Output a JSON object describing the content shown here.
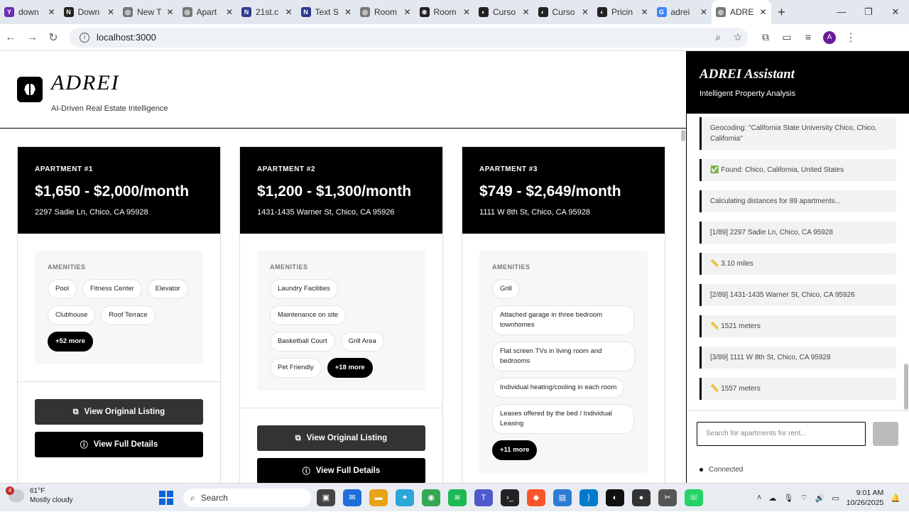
{
  "browser": {
    "tabs": [
      {
        "label": "down",
        "color": "#6b2fb3",
        "glyph": "Y"
      },
      {
        "label": "Down",
        "color": "#222",
        "glyph": "N"
      },
      {
        "label": "New T",
        "color": "#777",
        "glyph": "◎"
      },
      {
        "label": "Apart",
        "color": "#777",
        "glyph": "◎"
      },
      {
        "label": "21st.c",
        "color": "#2b3a8f",
        "glyph": "N"
      },
      {
        "label": "Text S",
        "color": "#2b3a8f",
        "glyph": "N"
      },
      {
        "label": "Room",
        "color": "#777",
        "glyph": "◎"
      },
      {
        "label": "Room",
        "color": "#222",
        "glyph": "⊛"
      },
      {
        "label": "Curso",
        "color": "#222",
        "glyph": "◐"
      },
      {
        "label": "Curso",
        "color": "#222",
        "glyph": "◐"
      },
      {
        "label": "Pricin",
        "color": "#222",
        "glyph": "◐"
      },
      {
        "label": "adrei",
        "color": "#4285f4",
        "glyph": "G"
      },
      {
        "label": "ADRE",
        "color": "#777",
        "glyph": "◎"
      }
    ],
    "url": "localhost:3000"
  },
  "header": {
    "brand": "ADREI",
    "tagline": "AI-Driven Real Estate Intelligence"
  },
  "apartments": [
    {
      "label": "APARTMENT #1",
      "price": "$1,650 - $2,000/month",
      "address": "2297 Sadie Ln, Chico, CA 95928",
      "amenities_title": "AMENITIES",
      "amenities": [
        "Pool",
        "Fitness Center",
        "Elevator",
        "Clubhouse",
        "Roof Terrace"
      ],
      "more": "+52 more",
      "view_listing": "View Original Listing",
      "view_details": "View Full Details"
    },
    {
      "label": "APARTMENT #2",
      "price": "$1,200 - $1,300/month",
      "address": "1431-1435 Warner St, Chico, CA 95926",
      "amenities_title": "AMENITIES",
      "amenities": [
        "Laundry Facilities",
        "Maintenance on site",
        "Basketball Court",
        "Grill Area",
        "Pet Friendly"
      ],
      "more": "+18 more",
      "view_listing": "View Original Listing",
      "view_details": "View Full Details"
    },
    {
      "label": "APARTMENT #3",
      "price": "$749 - $2,649/month",
      "address": "1111 W 8th St, Chico, CA 95928",
      "amenities_title": "AMENITIES",
      "amenities": [
        "Grill",
        "Attached garage in three bedroom townhomes",
        "Flat screen TVs in living room and bedrooms",
        "Individual heating/cooling in each room",
        "Leases offered by the bed / Individual Leasing"
      ],
      "more": "+11 more"
    }
  ],
  "assistant": {
    "title": "ADREI Assistant",
    "subtitle": "Intelligent Property Analysis",
    "log": [
      "Geocoding: \"California State University Chico, Chico, California\"",
      "✅ Found: Chico, California, United States",
      "Calculating distances for 89 apartments...",
      "[1/89] 2297 Sadie Ln, Chico, CA 95928",
      "📏 3.10 miles",
      "[2/89] 1431-1435 Warner St, Chico, CA 95926",
      "📏 1521 meters",
      "[3/89] 1111 W 8th St, Chico, CA 95928",
      "📏 1557 meters"
    ],
    "input_placeholder": "Search for apartments for rent...",
    "status": "Connected"
  },
  "taskbar": {
    "weather_temp": "61°F",
    "weather_desc": "Mostly cloudy",
    "weather_badge": "4",
    "search_label": "Search",
    "time": "9:01 AM",
    "date": "10/26/2025"
  }
}
